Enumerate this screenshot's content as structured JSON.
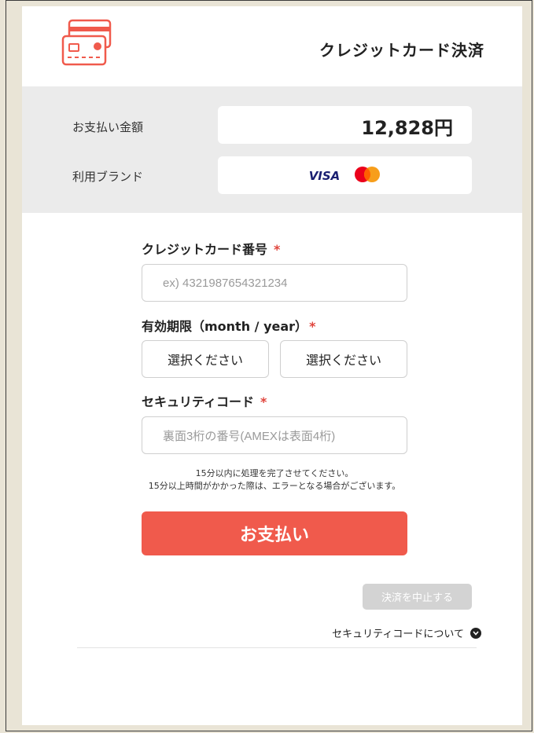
{
  "header": {
    "title": "クレジットカード決済",
    "icon": "credit-card-icon"
  },
  "summary": {
    "amount_label": "お支払い金額",
    "amount_value": "12,828円",
    "brand_label": "利用ブランド",
    "brands": [
      "VISA",
      "Mastercard"
    ]
  },
  "form": {
    "card_number": {
      "label": "クレジットカード番号",
      "required_mark": "*",
      "placeholder": "ex) 4321987654321234"
    },
    "expiry": {
      "label": "有効期限（month / year）",
      "required_mark": "*",
      "month_select": "選択ください",
      "year_select": "選択ください"
    },
    "security_code": {
      "label": "セキュリティコード",
      "required_mark": "*",
      "placeholder": "裏面3桁の番号(AMEXは表面4桁)"
    }
  },
  "notice": {
    "line1": "15分以内に処理を完了させてください。",
    "line2": "15分以上時間がかかった際は、エラーとなる場合がございます。"
  },
  "actions": {
    "pay_label": "お支払い",
    "cancel_label": "決済を中止する",
    "security_code_info": "セキュリティコードについて"
  },
  "colors": {
    "accent": "#f05a4c",
    "required": "#e0443c",
    "summary_bg": "#ebebeb",
    "cancel_bg": "#d3d3d3"
  }
}
